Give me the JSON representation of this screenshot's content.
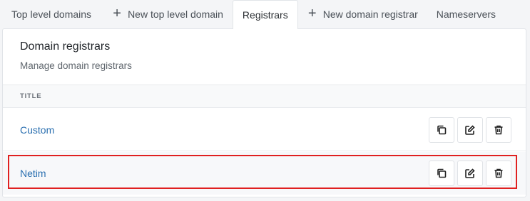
{
  "tabs": [
    {
      "label": "Top level domains",
      "icon": "",
      "active": false
    },
    {
      "label": "New top level domain",
      "icon": "plus-icon",
      "active": false
    },
    {
      "label": "Registrars",
      "icon": "",
      "active": true
    },
    {
      "label": "New domain registrar",
      "icon": "plus-icon",
      "active": false
    },
    {
      "label": "Nameservers",
      "icon": "",
      "active": false
    }
  ],
  "card": {
    "title": "Domain registrars",
    "subtitle": "Manage domain registrars"
  },
  "table": {
    "column_title": "TITLE",
    "rows": [
      {
        "title": "Custom",
        "actions": [
          "copy-icon",
          "edit-icon",
          "trash-icon"
        ]
      },
      {
        "title": "Netim",
        "actions": [
          "copy-icon",
          "edit-icon",
          "trash-icon"
        ],
        "highlighted": true
      }
    ]
  },
  "colors": {
    "link": "#2a6fb0",
    "highlight": "#e02020",
    "background": "#f4f5f7"
  }
}
